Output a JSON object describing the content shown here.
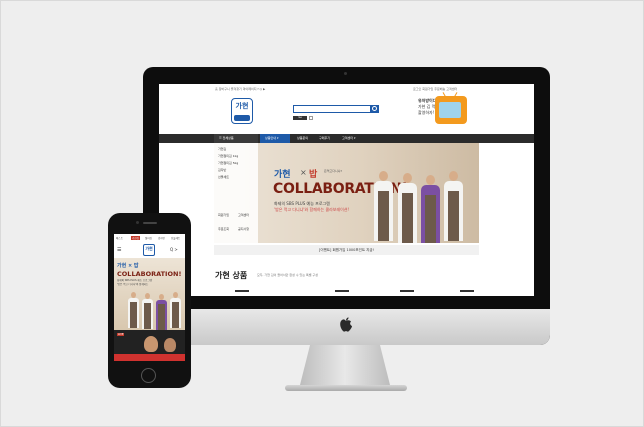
{
  "desktop": {
    "topbar_left": "홈 장바구니 즐겨찾기 마이페이지 f ◎ ▶",
    "topbar_right": "로그인 회원가입 주문배송 고객센터",
    "logo_text": "가현",
    "search_placeholder": "",
    "promo_title": "유저방이다",
    "promo_line1": "가현 김 먹방",
    "promo_line2": "촬영하자!",
    "nav_category": "☰ 전체상품",
    "nav_items": [
      "상품안내 ▾",
      "상품문의",
      "구매후기",
      "고객센터 ▾"
    ],
    "side_menu": [
      "가현김",
      "가현절미김 1kg",
      "가현절미김 5kg",
      "김자반",
      "선물세트"
    ],
    "side_icons": [
      "회원가입",
      "고객센터",
      "주문조회",
      "공지사항"
    ],
    "hero_brand": "가현",
    "hero_x": "×",
    "hero_partner": "밥",
    "hero_partner_sub": "은먹고다니냐?",
    "hero_title": "COLLABORATION!",
    "hero_line1": "화제의 SBS PLUS 예능 프로그램",
    "hero_line2": "'밥은 먹고 다니냐'와 함께하는 콜라보레이션!",
    "notice": "[이벤트] 회원가입 1000포인트 지급!",
    "section_title": "가현 상품",
    "section_subtitle": "모두, 가현 김이 들어서만 완성 수 있는 특별 구성"
  },
  "mobile": {
    "tabs": [
      "베스트",
      "가현김",
      "절미김",
      "김자반",
      "선물세트"
    ],
    "menu_icon": "☰",
    "logo_text": "가현",
    "right_icons": "Q  >",
    "hero_brand": "가현 × 밥",
    "hero_title": "COLLABORATION!",
    "hero_lines": [
      "화제의 SBS PLUS 예능 프로그램",
      "'밥은 먹고 다니냐'와 함께하는"
    ],
    "video_badge": "LIVE"
  },
  "colors": {
    "brand_blue": "#1e5aa8",
    "accent_red": "#c23a2b",
    "nav_dark": "#2b2b2b",
    "tv_orange": "#f39a1e"
  }
}
